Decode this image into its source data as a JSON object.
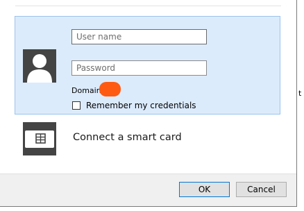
{
  "dialog": {
    "backdrop_fragment": "t",
    "credential_tile": {
      "username_placeholder": "User name",
      "password_placeholder": "Password",
      "domain_label": "Domain",
      "remember_label": "Remember my credentials",
      "remember_checked": false
    },
    "smartcard_tile": {
      "label": "Connect a smart card"
    },
    "buttons": {
      "ok": "OK",
      "cancel": "Cancel"
    },
    "colors": {
      "selected_tile_bg": "#dcebfc",
      "selected_tile_border": "#9bc3ec",
      "icon_bg": "#444444",
      "redaction": "#ff5a13",
      "footer_bg": "#f0f0f0",
      "default_button_border": "#0078d7"
    },
    "icons": {
      "user": "user-silhouette-icon",
      "smartcard": "smart-card-icon"
    }
  }
}
